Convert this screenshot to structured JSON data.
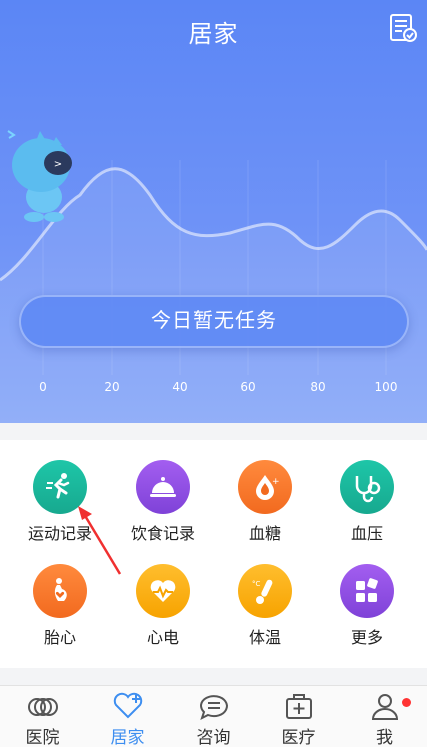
{
  "header": {
    "title": "居家"
  },
  "task": {
    "label": "今日暂无任务"
  },
  "scale": [
    "0",
    "20",
    "40",
    "60",
    "80",
    "100"
  ],
  "features": [
    {
      "label": "运动记录",
      "icon": "running-icon"
    },
    {
      "label": "饮食记录",
      "icon": "food-cover-icon"
    },
    {
      "label": "血糖",
      "icon": "blood-drop-icon"
    },
    {
      "label": "血压",
      "icon": "blood-pressure-icon"
    },
    {
      "label": "胎心",
      "icon": "pregnancy-icon"
    },
    {
      "label": "心电",
      "icon": "heart-pulse-icon"
    },
    {
      "label": "体温",
      "icon": "thermometer-icon"
    },
    {
      "label": "更多",
      "icon": "more-blocks-icon"
    }
  ],
  "tabs": [
    {
      "label": "医院",
      "icon": "hospital-icon"
    },
    {
      "label": "居家",
      "icon": "home-heart-icon"
    },
    {
      "label": "咨询",
      "icon": "chat-icon"
    },
    {
      "label": "医疗",
      "icon": "medical-kit-icon"
    },
    {
      "label": "我",
      "icon": "user-icon"
    }
  ]
}
